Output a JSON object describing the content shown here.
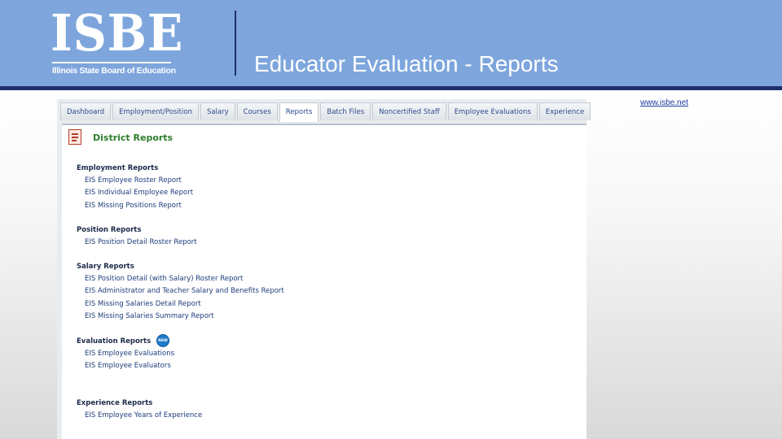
{
  "slide": {
    "logo_text": "ISBE",
    "logo_subtitle": "Illinois State Board of Education",
    "title": "Educator Evaluation - Reports",
    "website": "www.isbe.net"
  },
  "tabs": [
    {
      "label": "Dashboard",
      "active": false
    },
    {
      "label": "Employment/Position",
      "active": false
    },
    {
      "label": "Salary",
      "active": false
    },
    {
      "label": "Courses",
      "active": false
    },
    {
      "label": "Reports",
      "active": true
    },
    {
      "label": "Batch Files",
      "active": false
    },
    {
      "label": "Noncertified Staff",
      "active": false
    },
    {
      "label": "Employee Evaluations",
      "active": false
    },
    {
      "label": "Experience",
      "active": false
    }
  ],
  "panel": {
    "title": "District Reports",
    "icon": "report-document-icon"
  },
  "sections": {
    "employment": {
      "heading": "Employment Reports",
      "links": [
        "EIS Employee Roster Report",
        "EIS Individual Employee Report",
        "EIS Missing Positions Report"
      ]
    },
    "position": {
      "heading": "Position Reports",
      "links": [
        "EIS Position Detail Roster Report"
      ]
    },
    "salary": {
      "heading": "Salary Reports",
      "links": [
        "EIS Position Detail (with Salary) Roster Report",
        "EIS Administrator and Teacher Salary and Benefits Report",
        "EIS Missing Salaries Detail Report",
        "EIS Missing Salaries Summary Report"
      ]
    },
    "evaluation": {
      "heading": "Evaluation Reports",
      "badge": "NEW",
      "links": [
        "EIS Employee Evaluations",
        "EIS Employee Evaluators"
      ]
    },
    "experience": {
      "heading": "Experience Reports",
      "links": [
        "EIS Employee Years of Experience"
      ]
    }
  },
  "colors": {
    "header_bg": "#7ea6dd",
    "header_rule": "#1f2f6b",
    "panel_title": "#2e7d2e",
    "link": "#1c3d7a"
  }
}
